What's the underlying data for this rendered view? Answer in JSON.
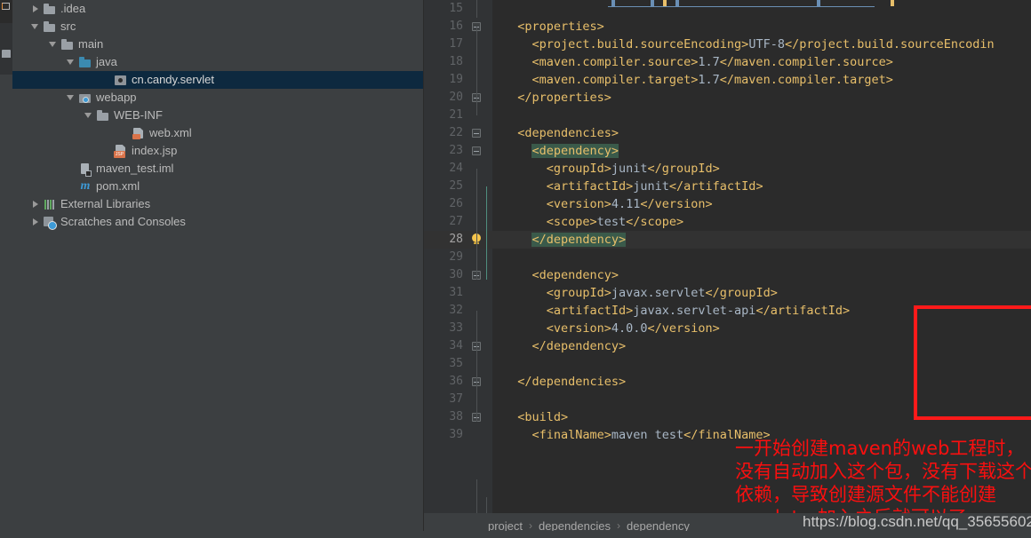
{
  "window": {
    "ide": "IntelliJ IDEA",
    "colors": {
      "sidebar_bg": "#3c3f41",
      "editor_bg": "#2b2b2b",
      "gutter_bg": "#313335",
      "selection_bg": "#0d293f",
      "current_line_bg": "#323232",
      "tag_color": "#e8bf6a",
      "text_color": "#a9b7c6",
      "annotation_red": "#fa0f0f",
      "tag_match_highlight": "#3a5a4a"
    }
  },
  "project_tree": {
    "items": [
      {
        "label": ".idea",
        "indent": 1,
        "arrow": "right",
        "icon": "folder-icon",
        "selected": false
      },
      {
        "label": "src",
        "indent": 1,
        "arrow": "down",
        "icon": "folder-icon",
        "selected": false
      },
      {
        "label": "main",
        "indent": 2,
        "arrow": "down",
        "icon": "folder-icon",
        "selected": false
      },
      {
        "label": "java",
        "indent": 3,
        "arrow": "down",
        "icon": "sources-folder-icon",
        "selected": false
      },
      {
        "label": "cn.candy.servlet",
        "indent": 5,
        "arrow": "none",
        "icon": "package-icon",
        "selected": true
      },
      {
        "label": "webapp",
        "indent": 3,
        "arrow": "down",
        "icon": "web-folder-icon",
        "selected": false
      },
      {
        "label": "WEB-INF",
        "indent": 4,
        "arrow": "down",
        "icon": "folder-icon",
        "selected": false
      },
      {
        "label": "web.xml",
        "indent": 6,
        "arrow": "none",
        "icon": "xml-file-icon",
        "selected": false
      },
      {
        "label": "index.jsp",
        "indent": 5,
        "arrow": "none",
        "icon": "jsp-file-icon",
        "selected": false
      },
      {
        "label": "maven_test.iml",
        "indent": 3,
        "arrow": "none",
        "icon": "iml-file-icon",
        "selected": false
      },
      {
        "label": "pom.xml",
        "indent": 3,
        "arrow": "none",
        "icon": "maven-file-icon",
        "selected": false
      },
      {
        "label": "External Libraries",
        "indent": 1,
        "arrow": "right",
        "icon": "libraries-icon",
        "selected": false
      },
      {
        "label": "Scratches and Consoles",
        "indent": 1,
        "arrow": "right",
        "icon": "scratches-icon",
        "selected": false
      }
    ]
  },
  "editor": {
    "file": "pom.xml",
    "lines": [
      {
        "num": "15",
        "indent": 0,
        "current": false,
        "fold": false,
        "bulb": false,
        "segments": []
      },
      {
        "num": "16",
        "indent": 1,
        "current": false,
        "fold": true,
        "bulb": false,
        "segments": [
          {
            "t": "tag",
            "s": "<properties>"
          }
        ]
      },
      {
        "num": "17",
        "indent": 2,
        "current": false,
        "fold": false,
        "bulb": false,
        "segments": [
          {
            "t": "tag",
            "s": "<project.build.sourceEncoding>"
          },
          {
            "t": "txt",
            "s": "UTF-8"
          },
          {
            "t": "tag",
            "s": "</project.build.sourceEncodin"
          }
        ]
      },
      {
        "num": "18",
        "indent": 2,
        "current": false,
        "fold": false,
        "bulb": false,
        "segments": [
          {
            "t": "tag",
            "s": "<maven.compiler.source>"
          },
          {
            "t": "txt",
            "s": "1.7"
          },
          {
            "t": "tag",
            "s": "</maven.compiler.source>"
          }
        ]
      },
      {
        "num": "19",
        "indent": 2,
        "current": false,
        "fold": false,
        "bulb": false,
        "segments": [
          {
            "t": "tag",
            "s": "<maven.compiler.target>"
          },
          {
            "t": "txt",
            "s": "1.7"
          },
          {
            "t": "tag",
            "s": "</maven.compiler.target>"
          }
        ]
      },
      {
        "num": "20",
        "indent": 1,
        "current": false,
        "fold": true,
        "bulb": false,
        "segments": [
          {
            "t": "tag",
            "s": "</properties>"
          }
        ]
      },
      {
        "num": "21",
        "indent": 0,
        "current": false,
        "fold": false,
        "bulb": false,
        "segments": []
      },
      {
        "num": "22",
        "indent": 1,
        "current": false,
        "fold": true,
        "bulb": false,
        "segments": [
          {
            "t": "tag",
            "s": "<dependencies>"
          }
        ]
      },
      {
        "num": "23",
        "indent": 2,
        "current": false,
        "fold": true,
        "bulb": false,
        "segments": [
          {
            "t": "tag hl",
            "s": "<dependency>"
          }
        ]
      },
      {
        "num": "24",
        "indent": 3,
        "current": false,
        "fold": false,
        "bulb": false,
        "segments": [
          {
            "t": "tag",
            "s": "<groupId>"
          },
          {
            "t": "txt",
            "s": "junit"
          },
          {
            "t": "tag",
            "s": "</groupId>"
          }
        ]
      },
      {
        "num": "25",
        "indent": 3,
        "current": false,
        "fold": false,
        "bulb": false,
        "segments": [
          {
            "t": "tag",
            "s": "<artifactId>"
          },
          {
            "t": "txt",
            "s": "junit"
          },
          {
            "t": "tag",
            "s": "</artifactId>"
          }
        ]
      },
      {
        "num": "26",
        "indent": 3,
        "current": false,
        "fold": false,
        "bulb": false,
        "segments": [
          {
            "t": "tag",
            "s": "<version>"
          },
          {
            "t": "txt",
            "s": "4.11"
          },
          {
            "t": "tag",
            "s": "</version>"
          }
        ]
      },
      {
        "num": "27",
        "indent": 3,
        "current": false,
        "fold": false,
        "bulb": false,
        "segments": [
          {
            "t": "tag",
            "s": "<scope>"
          },
          {
            "t": "txt",
            "s": "test"
          },
          {
            "t": "tag",
            "s": "</scope>"
          }
        ]
      },
      {
        "num": "28",
        "indent": 2,
        "current": true,
        "fold": true,
        "bulb": true,
        "segments": [
          {
            "t": "tag hl",
            "s": "</dependency>"
          }
        ]
      },
      {
        "num": "29",
        "indent": 0,
        "current": false,
        "fold": false,
        "bulb": false,
        "segments": []
      },
      {
        "num": "30",
        "indent": 2,
        "current": false,
        "fold": true,
        "bulb": false,
        "segments": [
          {
            "t": "tag",
            "s": "<dependency>"
          }
        ]
      },
      {
        "num": "31",
        "indent": 3,
        "current": false,
        "fold": false,
        "bulb": false,
        "segments": [
          {
            "t": "tag",
            "s": "<groupId>"
          },
          {
            "t": "txt",
            "s": "javax.servlet"
          },
          {
            "t": "tag",
            "s": "</groupId>"
          }
        ]
      },
      {
        "num": "32",
        "indent": 3,
        "current": false,
        "fold": false,
        "bulb": false,
        "segments": [
          {
            "t": "tag",
            "s": "<artifactId>"
          },
          {
            "t": "txt",
            "s": "javax.servlet-api"
          },
          {
            "t": "tag",
            "s": "</artifactId>"
          }
        ]
      },
      {
        "num": "33",
        "indent": 3,
        "current": false,
        "fold": false,
        "bulb": false,
        "segments": [
          {
            "t": "tag",
            "s": "<version>"
          },
          {
            "t": "txt",
            "s": "4.0.0"
          },
          {
            "t": "tag",
            "s": "</version>"
          }
        ]
      },
      {
        "num": "34",
        "indent": 2,
        "current": false,
        "fold": true,
        "bulb": false,
        "segments": [
          {
            "t": "tag",
            "s": "</dependency>"
          }
        ]
      },
      {
        "num": "35",
        "indent": 0,
        "current": false,
        "fold": false,
        "bulb": false,
        "segments": []
      },
      {
        "num": "36",
        "indent": 1,
        "current": false,
        "fold": true,
        "bulb": false,
        "segments": [
          {
            "t": "tag",
            "s": "</dependencies>"
          }
        ]
      },
      {
        "num": "37",
        "indent": 0,
        "current": false,
        "fold": false,
        "bulb": false,
        "segments": []
      },
      {
        "num": "38",
        "indent": 1,
        "current": false,
        "fold": true,
        "bulb": false,
        "segments": [
          {
            "t": "tag",
            "s": "<build>"
          }
        ]
      },
      {
        "num": "39",
        "indent": 2,
        "current": false,
        "fold": false,
        "bulb": false,
        "segments": [
          {
            "t": "tag",
            "s": "<finalName>"
          },
          {
            "t": "txt",
            "s": "maven test"
          },
          {
            "t": "tag",
            "s": "</finalName>"
          }
        ]
      }
    ]
  },
  "annotation": {
    "box_label": "red-highlight-box",
    "lines": [
      "一开始创建maven的web工程时，",
      "没有自动加入这个包，没有下载这个",
      "依赖，导致创建源文件不能创建",
      "servlet，加入之后就可以了"
    ]
  },
  "watermark": {
    "text": "https://blog.csdn.net/qq_35655602"
  },
  "breadcrumb": {
    "items": [
      "project",
      "dependencies",
      "dependency"
    ],
    "separator": "›"
  }
}
